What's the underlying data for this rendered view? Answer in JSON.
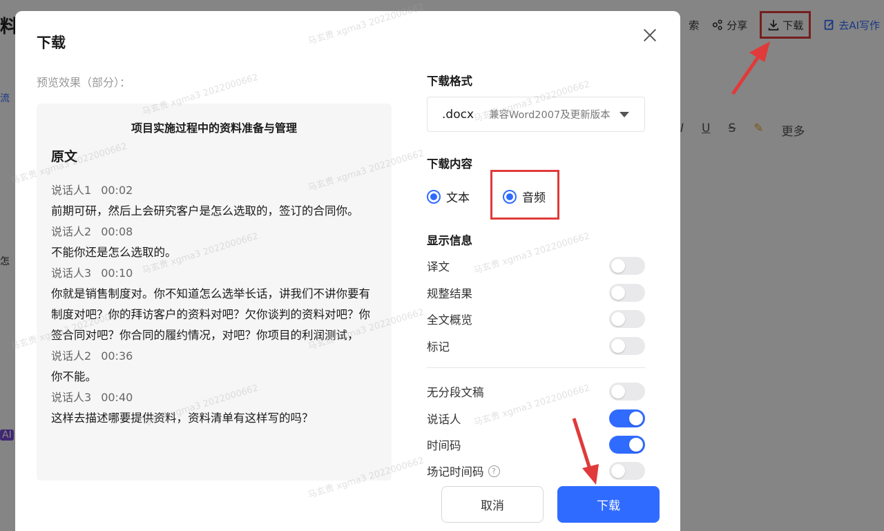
{
  "background": {
    "title": "料",
    "actions": {
      "search_label": "索",
      "share_label": "分享",
      "download_label": "下载",
      "ai_write_label": "去AI写作"
    },
    "format_bar": {
      "italic": "I",
      "underline": "U",
      "strike": "S",
      "more_label": "更多"
    },
    "left_tags": [
      "流",
      "怎",
      "AI"
    ]
  },
  "dialog": {
    "title": "下载",
    "preview_label": "预览效果（部分）：",
    "preview": {
      "doc_title": "项目实施过程中的资料准备与管理",
      "heading": "原文",
      "entries": [
        {
          "speaker": "说话人1",
          "time": "00:02",
          "text": "前期可研，然后上会研究客户是怎么选取的，签订的合同你。"
        },
        {
          "speaker": "说话人2",
          "time": "00:08",
          "text": "不能你还是怎么选取的。"
        },
        {
          "speaker": "说话人3",
          "time": "00:10",
          "text": "你就是销售制度对。你不知道怎么选举长话，讲我们不讲你要有制度对吧？你的拜访客户的资料对吧？欠你谈判的资料对吧？你签合同对吧？你合同的履约情况，对吧？你项目的利润测试，"
        },
        {
          "speaker": "说话人2",
          "time": "00:36",
          "text": "你不能。"
        },
        {
          "speaker": "说话人3",
          "time": "00:40",
          "text": "这样去描述哪要提供资料，资料清单有这样写的吗？"
        }
      ]
    },
    "format_section": {
      "label": "下载格式",
      "selected_ext": ".docx",
      "selected_desc": "兼容Word2007及更新版本"
    },
    "content_section": {
      "label": "下载内容",
      "options": [
        {
          "label": "文本",
          "checked": true
        },
        {
          "label": "音频",
          "checked": true
        }
      ]
    },
    "display_section": {
      "label": "显示信息",
      "toggles": [
        {
          "label": "译文",
          "on": false
        },
        {
          "label": "规整结果",
          "on": false
        },
        {
          "label": "全文概览",
          "on": false
        },
        {
          "label": "标记",
          "on": false
        }
      ],
      "toggles2": [
        {
          "label": "无分段文稿",
          "on": false
        },
        {
          "label": "说话人",
          "on": true
        },
        {
          "label": "时间码",
          "on": true
        },
        {
          "label": "场记时间码",
          "on": false,
          "help": "?"
        }
      ]
    },
    "buttons": {
      "cancel": "取消",
      "download": "下载"
    }
  },
  "watermark_text": "马玄贵 xgma3 2022000662",
  "colors": {
    "accent": "#2f6bff",
    "highlight": "#e03a3a"
  }
}
